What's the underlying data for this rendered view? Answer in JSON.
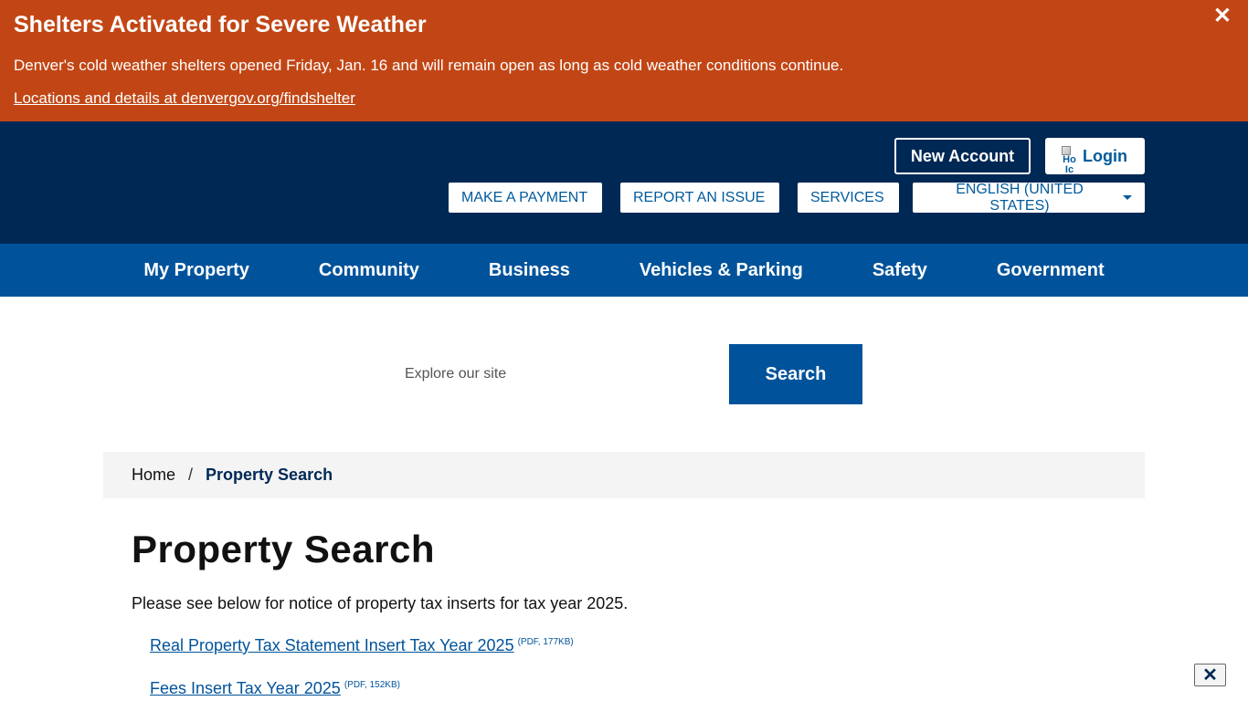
{
  "alert": {
    "title": "Shelters Activated for Severe Weather",
    "text": "Denver's cold weather shelters opened Friday, Jan. 16 and will remain open as long as cold weather conditions continue.",
    "link": "Locations and details at denvergov.org/findshelter",
    "close": "✕"
  },
  "header": {
    "new_account": "New Account",
    "login": "Login",
    "login_icon_alt": "Ho Ic",
    "utility": {
      "pay": "MAKE A PAYMENT",
      "report": "REPORT AN ISSUE",
      "services": "SERVICES",
      "language": "ENGLISH (UNITED STATES)"
    }
  },
  "nav": {
    "items": [
      "My Property",
      "Community",
      "Business",
      "Vehicles & Parking",
      "Safety",
      "Government"
    ]
  },
  "search": {
    "placeholder": "Explore our site",
    "button": "Search"
  },
  "breadcrumb": {
    "home": "Home",
    "separator": "/",
    "current": "Property Search"
  },
  "content": {
    "title": "Property Search",
    "intro": "Please see below for notice of property tax inserts for tax year 2025.",
    "docs": [
      {
        "label": "Real Property Tax Statement Insert Tax Year 2025",
        "meta": "(PDF, 177KB)"
      },
      {
        "label": "Fees Insert Tax Year 2025",
        "meta": "(PDF, 152KB)"
      }
    ]
  },
  "floating_close": "✕",
  "colors": {
    "alert_bg": "#c24615",
    "header_bg": "#002855",
    "nav_bg": "#00539b",
    "link": "#00539b"
  }
}
